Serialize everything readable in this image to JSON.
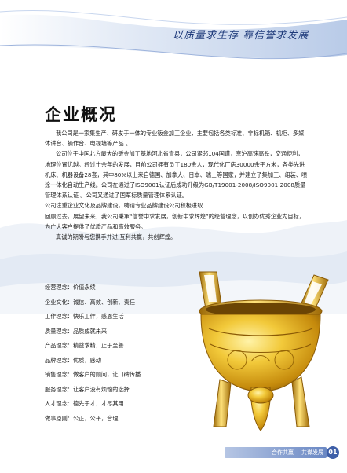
{
  "header": {
    "slogan": "以质量求生存 靠信誉求发展"
  },
  "title": "企业概况",
  "paragraphs": [
    "我公司是一家集生产、研发于一体的专业钣金加工企业，主要包括各类标准、非标机箱、机柜、多媒体讲台、操作台、电视墙等产品 。",
    "公司位于中国北方最大的钣金加工基地河北省青县，公司紧邻104国道，京沪高速高铁，交通便利，地理位置优越。经过十余年的发展，目前公司拥有员工180余人，现代化厂房30000余平方米，各类先进机床、机器设备28套，其中80%以上来自德国、加拿大、日本、瑞士等国家，并建立了集加工、组装、喷涂一体化自动生产线。公司在通过了ISO9001认证后成功升级为GB/T19001-2008/ISO9001:2008质量管理体系认证 。公司又通过了国军标质量管理体系认证。",
    "公司注重企业文化及品牌建设，聘请专业品牌建设公司积极进取",
    "回顾过去，展望未来，我公司秉承“信誉中求发展，创新中求辉煌”的经营理念，以创办优秀企业为目标，为广大客户提供了优质产品和高效服务。",
    "真诚的期盼与您携手并进,互利共赢，共创辉煌。"
  ],
  "values": [
    {
      "key": "经营理念：",
      "val": "价值永续"
    },
    {
      "key": "企业文化：",
      "val": "诚信、高效、创新、责任"
    },
    {
      "key": "工作理念：",
      "val": "快乐工作，感恩生活"
    },
    {
      "key": "质量理念：",
      "val": "品质成就未来"
    },
    {
      "key": "产品理念：",
      "val": "精益求精，止于至善"
    },
    {
      "key": "品牌理念：",
      "val": "优质，感动"
    },
    {
      "key": "销售理念：",
      "val": "做客户的顾问，让口碑传播"
    },
    {
      "key": "服务理念：",
      "val": "让客户没有烦恼的选择"
    },
    {
      "key": "人才理念：",
      "val": "德先于才，才尽其用"
    },
    {
      "key": "做事原则：",
      "val": "公正，公平，合理"
    }
  ],
  "footer": {
    "text1": "合作共赢",
    "text2": "共谋发展",
    "page": "01"
  },
  "colors": {
    "accent": "#3e5fa8",
    "slogan": "#1e3a7a",
    "gold": "#d4a017"
  }
}
